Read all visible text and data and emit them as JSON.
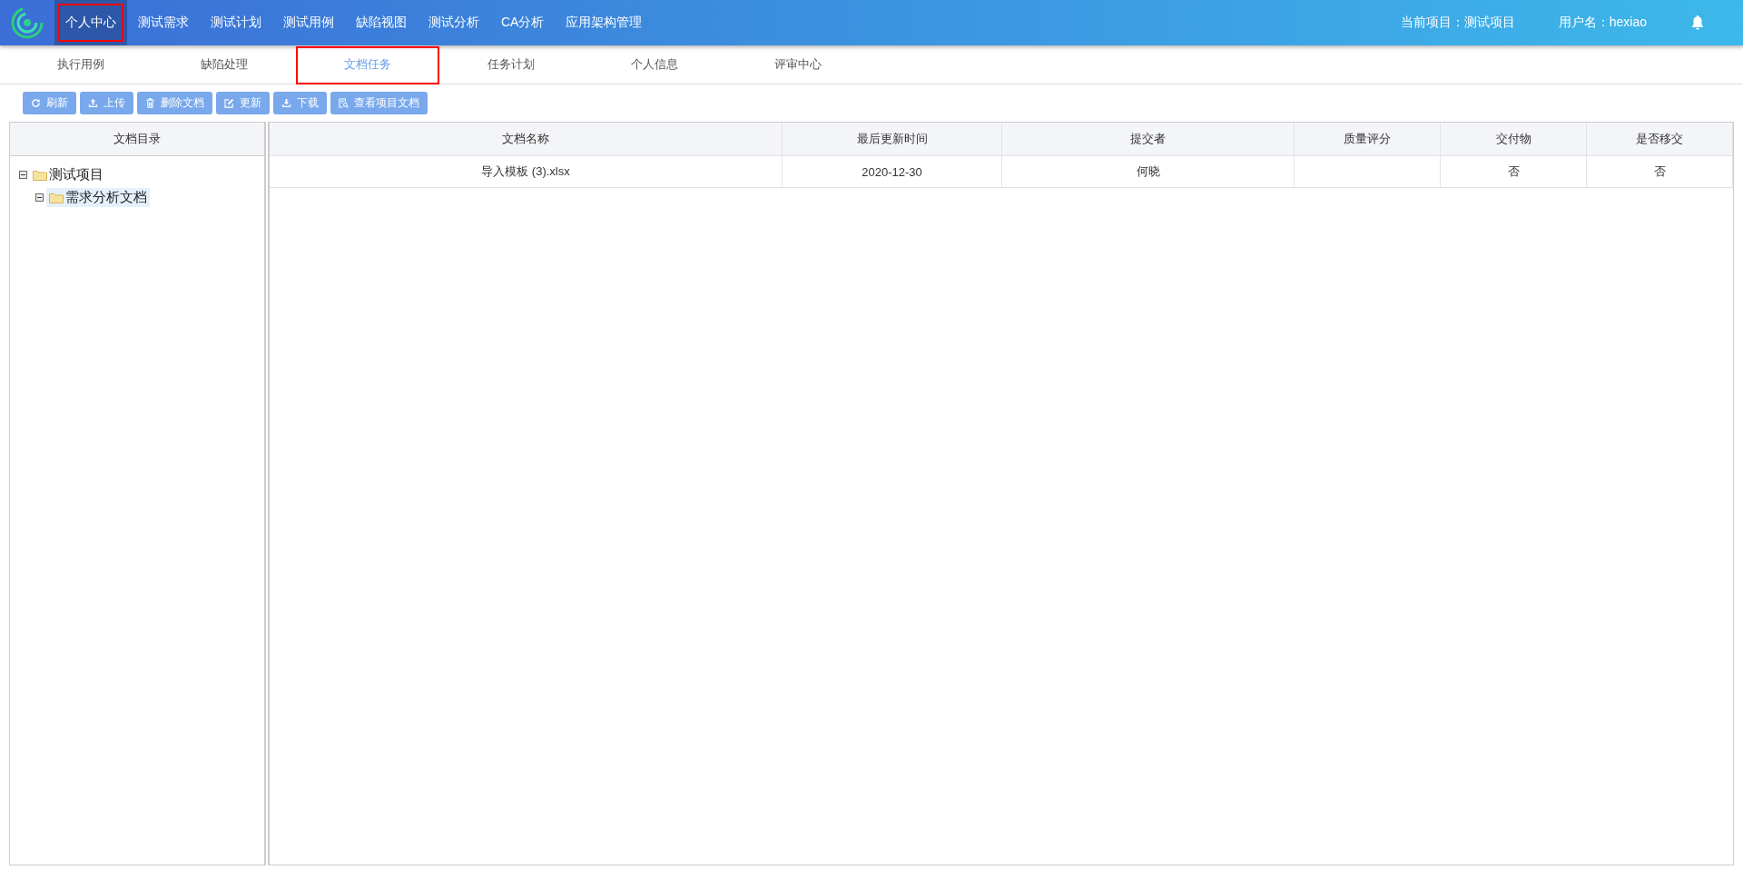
{
  "nav": {
    "items": [
      {
        "label": "个人中心",
        "selected": true,
        "highlighted": true
      },
      {
        "label": "测试需求",
        "selected": false,
        "highlighted": false
      },
      {
        "label": "测试计划",
        "selected": false,
        "highlighted": false
      },
      {
        "label": "测试用例",
        "selected": false,
        "highlighted": false
      },
      {
        "label": "缺陷视图",
        "selected": false,
        "highlighted": false
      },
      {
        "label": "测试分析",
        "selected": false,
        "highlighted": false
      },
      {
        "label": "CA分析",
        "selected": false,
        "highlighted": false
      },
      {
        "label": "应用架构管理",
        "selected": false,
        "highlighted": false
      }
    ],
    "current_project": "当前项目：测试项目",
    "username": "用户名：hexiao"
  },
  "tabs": [
    {
      "label": "执行用例",
      "selected": false,
      "highlighted": false
    },
    {
      "label": "缺陷处理",
      "selected": false,
      "highlighted": false
    },
    {
      "label": "文档任务",
      "selected": true,
      "highlighted": true
    },
    {
      "label": "任务计划",
      "selected": false,
      "highlighted": false
    },
    {
      "label": "个人信息",
      "selected": false,
      "highlighted": false
    },
    {
      "label": "评审中心",
      "selected": false,
      "highlighted": false
    }
  ],
  "toolbar": [
    {
      "label": "刷新",
      "kind": "refresh"
    },
    {
      "label": "上传",
      "kind": "upload"
    },
    {
      "label": "删除文档",
      "kind": "delete"
    },
    {
      "label": "更新",
      "kind": "edit"
    },
    {
      "label": "下载",
      "kind": "download"
    },
    {
      "label": "查看项目文档",
      "kind": "view"
    }
  ],
  "tree": {
    "title": "文档目录",
    "nodes": [
      {
        "label": "测试项目",
        "expanded": true,
        "selected": false,
        "children": [
          {
            "label": "需求分析文档",
            "expanded": true,
            "selected": true
          }
        ]
      }
    ]
  },
  "table": {
    "columns": [
      "文档名称",
      "最后更新时间",
      "提交者",
      "质量评分",
      "交付物",
      "是否移交"
    ],
    "rows": [
      [
        "导入模板 (3).xlsx",
        "2020-12-30",
        "何晓",
        "",
        "否",
        "否"
      ]
    ]
  }
}
